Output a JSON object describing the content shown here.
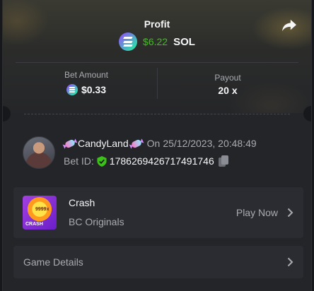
{
  "header": {
    "title": "Profit",
    "profit_value": "$6.22",
    "profit_currency": "SOL",
    "colors": {
      "profit_green": "#3bc117",
      "sol_gradient_start": "#9945ff",
      "sol_gradient_end": "#19fb9b"
    }
  },
  "stats": {
    "bet_amount_label": "Bet Amount",
    "bet_amount_value": "$0.33",
    "payout_label": "Payout",
    "payout_value": "20 x"
  },
  "player": {
    "name": "CandyLand",
    "on_label": "On",
    "datetime": "25/12/2023, 20:48:49",
    "bet_id_label": "Bet ID:",
    "bet_id": "1786269426717491746"
  },
  "game": {
    "name": "Crash",
    "provider": "BC Originals",
    "action_label": "Play Now",
    "thumb_label": "CRASH",
    "thumb_badge": "9999x"
  },
  "details": {
    "label": "Game Details"
  },
  "icons": [
    "share-icon",
    "sol-icon",
    "candy-icon",
    "verified-shield-icon",
    "copy-icon",
    "chevron-right-icon"
  ]
}
